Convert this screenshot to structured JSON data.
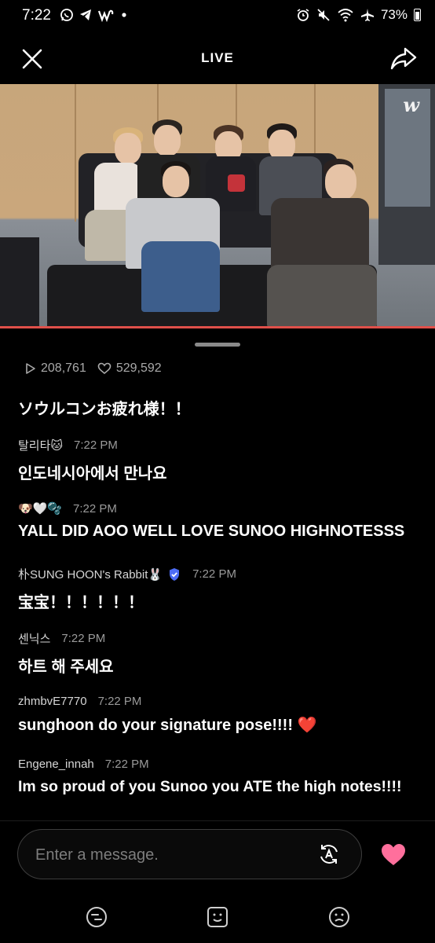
{
  "status_bar": {
    "time": "7:22",
    "battery": "73%",
    "left_icons": [
      "whatsapp-icon",
      "telegram-icon",
      "weverse-icon",
      "dot-icon"
    ],
    "right_icons": [
      "alarm-icon",
      "mute-icon",
      "wifi-icon",
      "airplane-icon",
      "battery-icon"
    ]
  },
  "header": {
    "title": "LIVE"
  },
  "video": {
    "logo": "w",
    "progress_color": "#e0504a"
  },
  "stats": {
    "views": "208,761",
    "likes": "529,592"
  },
  "chat": {
    "messages": [
      {
        "author": "",
        "time": "",
        "text": "ソウルコンお疲れ様！！"
      },
      {
        "author": "탈리타🐱",
        "time": "7:22 PM",
        "text": "인도네시아에서 만나요"
      },
      {
        "author": "🐶🤍🫧",
        "time": "7:22 PM",
        "text": "YALL DID AOO WELL LOVE SUNOO HIGHNOTESSS"
      },
      {
        "author": "朴SUNG HOON's Rabbit🐰",
        "time": "7:22 PM",
        "text": "宝宝！！！！！！"
      },
      {
        "author": "센닉스",
        "time": "7:22 PM",
        "text": "하트 해 주세요"
      },
      {
        "author": "zhmbvE7770",
        "time": "7:22 PM",
        "text": "sunghoon do your signature pose!!!! ❤️"
      },
      {
        "author": "Engene_innah",
        "time": "7:22 PM",
        "text": "Im so proud of you Sunoo you ATE the high notes!!!!"
      }
    ]
  },
  "composer": {
    "placeholder": "Enter a message."
  },
  "colors": {
    "heart": "#ff6f9c",
    "background": "#000000"
  }
}
